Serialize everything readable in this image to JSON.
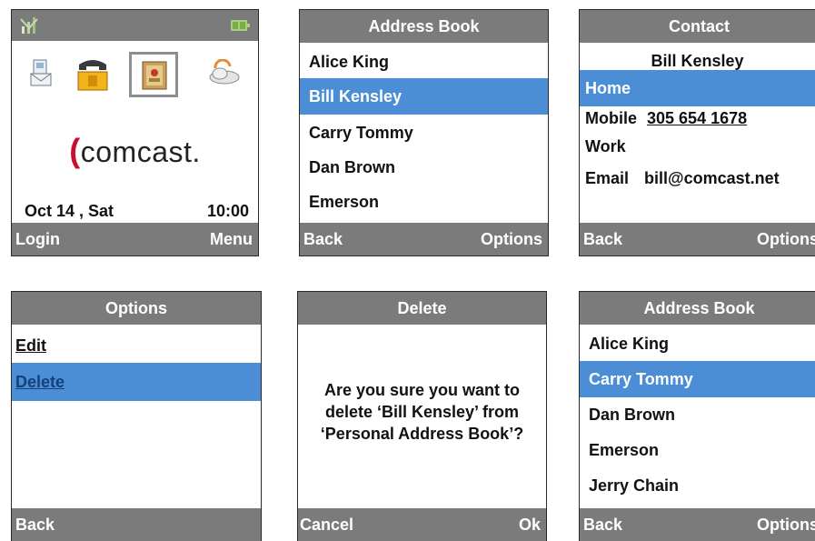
{
  "home": {
    "logo_text": "comcast.",
    "date": "Oct 14 , Sat",
    "time": "10:00",
    "soft_left": "Login",
    "soft_right": "Menu",
    "icons": [
      "signal-icon",
      "battery-icon",
      "messages-icon",
      "phone-icon",
      "address-book-icon",
      "weather-icon"
    ]
  },
  "address_book_1": {
    "title": "Address Book",
    "items": [
      "Alice King",
      "Bill Kensley",
      "Carry Tommy",
      "Dan Brown",
      "Emerson"
    ],
    "selected": "Bill Kensley",
    "soft_left": "Back",
    "soft_right": "Options"
  },
  "contact": {
    "title": "Contact",
    "name": "Bill Kensley",
    "home_label": "Home",
    "mobile_label": "Mobile",
    "mobile_value": "305 654 1678",
    "work_label": "Work",
    "email_label": "Email",
    "email_value": "bill@comcast.net",
    "soft_left": "Back",
    "soft_right": "Options"
  },
  "options": {
    "title": "Options",
    "items": [
      "Edit",
      "Delete"
    ],
    "selected": "Delete",
    "soft_left": "Back"
  },
  "delete": {
    "title": "Delete",
    "message": "Are you sure you want to delete ‘Bill Kensley’ from ‘Personal Address Book’?",
    "soft_left": "Cancel",
    "soft_right": "Ok"
  },
  "address_book_2": {
    "title": "Address Book",
    "items": [
      "Alice King",
      "Carry Tommy",
      "Dan Brown",
      "Emerson",
      "Jerry Chain"
    ],
    "selected": "Carry Tommy",
    "soft_left": "Back",
    "soft_right": "Options"
  },
  "colors": {
    "bar": "#7b7b7b",
    "selection": "#4b8ed6",
    "brand": "#c8102e"
  }
}
